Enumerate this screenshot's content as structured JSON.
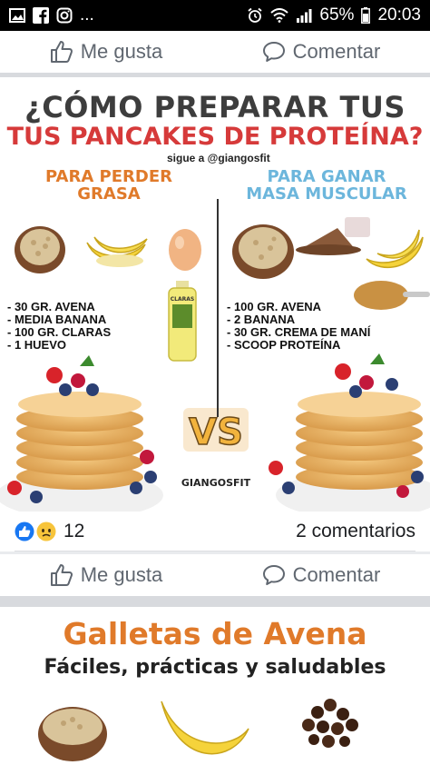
{
  "status_bar": {
    "time": "20:03",
    "battery": "65%",
    "dots": "..."
  },
  "actions": {
    "like_label": "Me gusta",
    "comment_label": "Comentar"
  },
  "post_image": {
    "headline_line1": "¿CÓMO PREPARAR TUS",
    "headline_line2": "TUS PANCAKES DE PROTEÍNA?",
    "follow_text": "sigue a @giangosfit",
    "left_title_line1": "PARA PERDER",
    "left_title_line2": "GRASA",
    "right_title_line1": "PARA GANAR",
    "right_title_line2": "MASA MUSCULAR",
    "left_ingredients": [
      "-   30 GR.  AVENA",
      "-   MEDIA BANANA",
      "-   100 GR. CLARAS",
      "-   1 HUEVO"
    ],
    "right_ingredients": [
      "- 100 GR. AVENA",
      "- 2 BANANA",
      "- 30 GR. CREMA DE MANÍ",
      "- SCOOP PROTEÍNA"
    ],
    "vs_text": "VS",
    "logo_text": "GIANGOSFIT",
    "bottle_label": "CLARAS"
  },
  "reactions": {
    "count": "12",
    "comments": "2 comentarios"
  },
  "next_post": {
    "title": "Galletas de Avena",
    "subtitle": "Fáciles, prácticas y saludables"
  },
  "colors": {
    "facebook_blue": "#1877f2",
    "orange": "#e07a2a",
    "red": "#d63a3a",
    "light_blue": "#6cb6dc"
  }
}
